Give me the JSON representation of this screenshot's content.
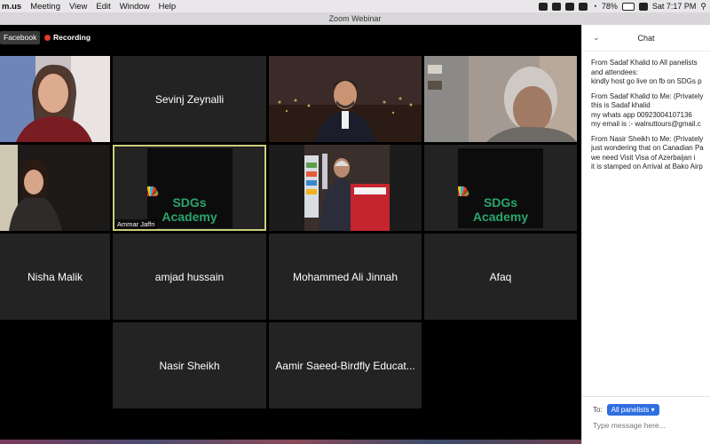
{
  "menubar": {
    "app": "m.us",
    "items": [
      "Meeting",
      "View",
      "Edit",
      "Window",
      "Help"
    ],
    "battery": "78%",
    "clock": "Sat 7:17 PM"
  },
  "window": {
    "title": "Zoom Webinar"
  },
  "badges": {
    "facebook": "Facebook",
    "recording": "Recording"
  },
  "tiles": {
    "sevinj": "Sevinj Zeynalli",
    "ammar_tag": "Ammar Jaffri",
    "sdg_top": "SDGs",
    "sdg_bottom": "Academy",
    "nisha": "Nisha Malik",
    "amjad": "amjad hussain",
    "jinnah": "Mohammed Ali Jinnah",
    "afaq": "Afaq",
    "nasir": "Nasir Sheikh",
    "aamir": "Aamir Saeed-Birdfly Educat..."
  },
  "chat": {
    "title": "Chat",
    "messages": [
      {
        "from_label": "From",
        "sender": "Sadaf Khalid",
        "to_label": "to",
        "to": "All panelists",
        "to_extra": "and attendees:",
        "lines": [
          "kindly host go live on fb on SDGs p"
        ]
      },
      {
        "from_label": "From",
        "sender": "Sadaf Khalid",
        "to_label": "to Me:",
        "private": "(Privately",
        "lines": [
          "this is Sadaf khalid",
          "my whats app 00923004107136",
          "my email is :- walnuttours@gmail.c"
        ]
      },
      {
        "from_label": "From",
        "sender": "Nasir Sheikh",
        "to_label": "to Me:",
        "private": "(Privately",
        "lines": [
          "just wondering that on Canadian Pa",
          "we need Visit Visa of Azerbaijan i",
          "it is stamped on Arrival at Bako Airp"
        ]
      }
    ],
    "to_label": "To:",
    "to_value": "All panelists",
    "input_placeholder": "Type message here..."
  },
  "colors": {
    "accent": "#2f6ee0",
    "active_border": "#c9cf7a",
    "private": "#d63a3a",
    "link": "#3a73c5"
  }
}
